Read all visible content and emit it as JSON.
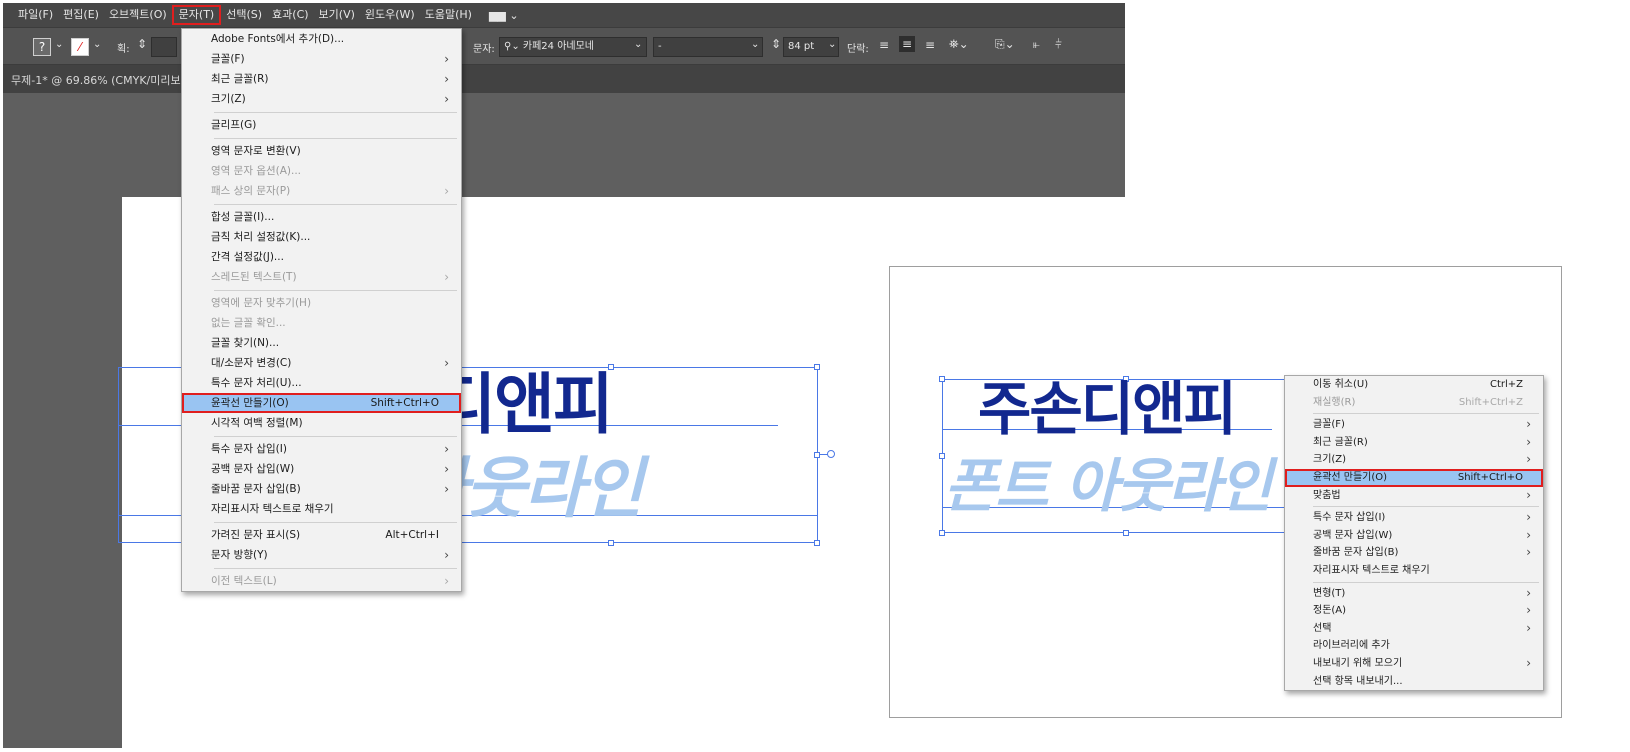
{
  "menubar": {
    "items": [
      "파일(F)",
      "편집(E)",
      "오브젝트(O)",
      "문자(T)",
      "선택(S)",
      "효과(C)",
      "보기(V)",
      "윈도우(W)",
      "도움말(H)"
    ],
    "active_index": 3,
    "workspace_icon": "▆▆ ⌄"
  },
  "controlbar": {
    "stroke_label": "획:",
    "type_label": "문자:",
    "font_name": "카페24 아네모네",
    "font_style": "-",
    "font_size": "84 pt",
    "paragraph_label": "단락:"
  },
  "document": {
    "tab_label": "무제-1* @ 69.86% (CMYK/미리보"
  },
  "artwork": {
    "line1": "주손디앤피",
    "line2": "폰트 아웃라인"
  },
  "type_menu": {
    "items": [
      {
        "label": "Adobe Fonts에서 추가(D)...",
        "shortcut": "",
        "arrow": false,
        "disabled": false
      },
      {
        "label": "글꼴(F)",
        "shortcut": "",
        "arrow": true,
        "disabled": false
      },
      {
        "label": "최근 글꼴(R)",
        "shortcut": "",
        "arrow": true,
        "disabled": false
      },
      {
        "label": "크기(Z)",
        "shortcut": "",
        "arrow": true,
        "disabled": false
      },
      {
        "sep": true
      },
      {
        "label": "글리프(G)",
        "shortcut": "",
        "arrow": false,
        "disabled": false
      },
      {
        "sep": true
      },
      {
        "label": "영역 문자로 변환(V)",
        "shortcut": "",
        "arrow": false,
        "disabled": false
      },
      {
        "label": "영역 문자 옵션(A)...",
        "shortcut": "",
        "arrow": false,
        "disabled": true
      },
      {
        "label": "패스 상의 문자(P)",
        "shortcut": "",
        "arrow": true,
        "disabled": true
      },
      {
        "sep": true
      },
      {
        "label": "합성 글꼴(I)...",
        "shortcut": "",
        "arrow": false,
        "disabled": false
      },
      {
        "label": "금칙 처리 설정값(K)...",
        "shortcut": "",
        "arrow": false,
        "disabled": false
      },
      {
        "label": "간격 설정값(J)...",
        "shortcut": "",
        "arrow": false,
        "disabled": false
      },
      {
        "label": "스레드된 텍스트(T)",
        "shortcut": "",
        "arrow": true,
        "disabled": true
      },
      {
        "sep": true
      },
      {
        "label": "영역에 문자 맞추기(H)",
        "shortcut": "",
        "arrow": false,
        "disabled": true
      },
      {
        "label": "없는 글꼴 확인...",
        "shortcut": "",
        "arrow": false,
        "disabled": true
      },
      {
        "label": "글꼴 찾기(N)...",
        "shortcut": "",
        "arrow": false,
        "disabled": false
      },
      {
        "label": "대/소문자 변경(C)",
        "shortcut": "",
        "arrow": true,
        "disabled": false
      },
      {
        "label": "특수 문자 처리(U)...",
        "shortcut": "",
        "arrow": false,
        "disabled": false
      },
      {
        "label": "윤곽선 만들기(O)",
        "shortcut": "Shift+Ctrl+O",
        "arrow": false,
        "disabled": false,
        "highlight": true
      },
      {
        "label": "시각적 여백 정렬(M)",
        "shortcut": "",
        "arrow": false,
        "disabled": false
      },
      {
        "sep": true
      },
      {
        "label": "특수 문자 삽입(I)",
        "shortcut": "",
        "arrow": true,
        "disabled": false
      },
      {
        "label": "공백 문자 삽입(W)",
        "shortcut": "",
        "arrow": true,
        "disabled": false
      },
      {
        "label": "줄바꿈 문자 삽입(B)",
        "shortcut": "",
        "arrow": true,
        "disabled": false
      },
      {
        "label": "자리표시자 텍스트로 채우기",
        "shortcut": "",
        "arrow": false,
        "disabled": false
      },
      {
        "sep": true
      },
      {
        "label": "가려진 문자 표시(S)",
        "shortcut": "Alt+Ctrl+I",
        "arrow": false,
        "disabled": false
      },
      {
        "label": "문자 방향(Y)",
        "shortcut": "",
        "arrow": true,
        "disabled": false
      },
      {
        "sep": true
      },
      {
        "label": "이전 텍스트(L)",
        "shortcut": "",
        "arrow": true,
        "disabled": true
      }
    ]
  },
  "context_menu": {
    "items": [
      {
        "label": "이동 취소(U)",
        "shortcut": "Ctrl+Z",
        "arrow": false,
        "disabled": false
      },
      {
        "label": "재실행(R)",
        "shortcut": "Shift+Ctrl+Z",
        "arrow": false,
        "disabled": true
      },
      {
        "sep": true
      },
      {
        "label": "글꼴(F)",
        "shortcut": "",
        "arrow": true,
        "disabled": false
      },
      {
        "label": "최근 글꼴(R)",
        "shortcut": "",
        "arrow": true,
        "disabled": false
      },
      {
        "label": "크기(Z)",
        "shortcut": "",
        "arrow": true,
        "disabled": false
      },
      {
        "label": "윤곽선 만들기(O)",
        "shortcut": "Shift+Ctrl+O",
        "arrow": false,
        "disabled": false,
        "highlight": true
      },
      {
        "label": "맞춤법",
        "shortcut": "",
        "arrow": true,
        "disabled": false
      },
      {
        "sep": true
      },
      {
        "label": "특수 문자 삽입(I)",
        "shortcut": "",
        "arrow": true,
        "disabled": false
      },
      {
        "label": "공백 문자 삽입(W)",
        "shortcut": "",
        "arrow": true,
        "disabled": false
      },
      {
        "label": "줄바꿈 문자 삽입(B)",
        "shortcut": "",
        "arrow": true,
        "disabled": false
      },
      {
        "label": "자리표시자 텍스트로 채우기",
        "shortcut": "",
        "arrow": false,
        "disabled": false
      },
      {
        "sep": true
      },
      {
        "label": "변형(T)",
        "shortcut": "",
        "arrow": true,
        "disabled": false
      },
      {
        "label": "정돈(A)",
        "shortcut": "",
        "arrow": true,
        "disabled": false
      },
      {
        "label": "선택",
        "shortcut": "",
        "arrow": true,
        "disabled": false
      },
      {
        "label": "라이브러리에 추가",
        "shortcut": "",
        "arrow": false,
        "disabled": false
      },
      {
        "label": "내보내기 위해 모으기",
        "shortcut": "",
        "arrow": true,
        "disabled": false
      },
      {
        "label": "선택 항목 내보내기...",
        "shortcut": "",
        "arrow": false,
        "disabled": false
      }
    ]
  },
  "colors": {
    "highlight_fill": "#99c4f2",
    "highlight_border": "#e01e1e",
    "title_dark": "#12288f",
    "title_light": "#a7c8ee",
    "selection": "#4a78e6"
  }
}
